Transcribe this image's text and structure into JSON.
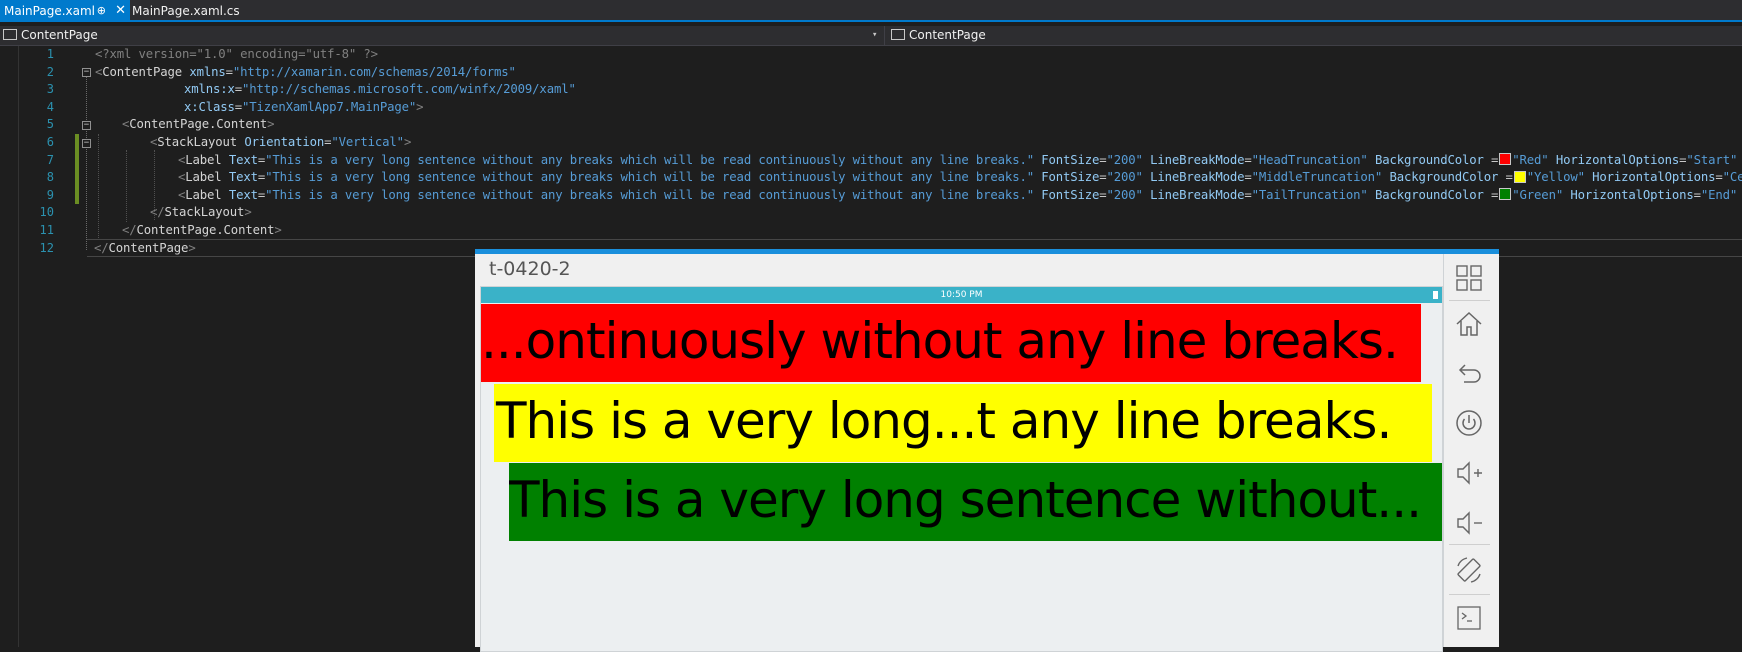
{
  "tabs": [
    {
      "label": "MainPage.xaml",
      "active": true,
      "pin": "⊕",
      "close": "✕"
    },
    {
      "label": "MainPage.xaml.cs",
      "active": false
    }
  ],
  "nav": {
    "left": "ContentPage",
    "right": "ContentPage"
  },
  "line_numbers": [
    "1",
    "2",
    "3",
    "4",
    "5",
    "6",
    "7",
    "8",
    "9",
    "10",
    "11",
    "12"
  ],
  "code": {
    "l1": "<?xml version=\"1.0\" encoding=\"utf-8\" ?>",
    "l2_tag": "ContentPage",
    "l2_attr": "xmlns",
    "l2_val": "\"http://xamarin.com/schemas/2014/forms\"",
    "l3_attr": "xmlns:x",
    "l3_val": "\"http://schemas.microsoft.com/winfx/2009/xaml\"",
    "l4_attr": "x:Class",
    "l4_val": "\"TizenXamlApp7.MainPage\"",
    "l5_tag": "ContentPage.Content",
    "l6_tag": "StackLayout",
    "l6_attr": "Orientation",
    "l6_val": "\"Vertical\"",
    "label_tag": "Label",
    "text_attr": "Text",
    "text_val": "\"This is a very long sentence without any breaks which will be read continuously without any line breaks.\"",
    "fontsize_attr": "FontSize",
    "fontsize_val": "\"200\"",
    "lbm_attr": "LineBreakMode",
    "bg_attr": "BackgroundColor",
    "ho_attr": "HorizontalOptions",
    "l7_lbm": "\"HeadTruncation\"",
    "l7_bg": "\"Red\"",
    "l7_ho": "\"Start\"",
    "l8_lbm": "\"MiddleTruncation\"",
    "l8_bg": "\"Yellow\"",
    "l8_ho": "\"Center\"",
    "l9_lbm": "\"TailTruncation\"",
    "l9_bg": "\"Green\"",
    "l9_ho": "\"End\"",
    "l10_tag": "StackLayout",
    "l11_tag": "ContentPage.Content",
    "l12_tag": "ContentPage",
    "eq": "=",
    "close_sl": " />",
    "close": ">"
  },
  "colors": {
    "red": "#ff0000",
    "yellow": "#ffff00",
    "green": "#008000",
    "accent": "#007acc"
  },
  "emulator": {
    "title": "t-0420-2",
    "time": "10:50 PM",
    "labels": [
      {
        "text": "...ontinuously without any line breaks.",
        "color": "#ff0000"
      },
      {
        "text": "This is a very long...t any line breaks.",
        "color": "#ffff00"
      },
      {
        "text": "This is a very long sentence without...",
        "color": "#008000"
      }
    ],
    "side_icons": [
      "apps-icon",
      "home-icon",
      "back-icon",
      "power-icon",
      "volume-up-icon",
      "volume-down-icon",
      "rotate-icon",
      "terminal-icon"
    ]
  }
}
